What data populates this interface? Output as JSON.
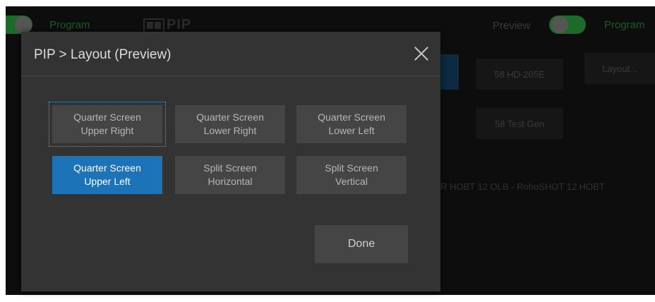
{
  "background": {
    "program_left": "Program",
    "title": "PIP",
    "preview": "Preview",
    "program_right": "Program",
    "btn_hd": "58 HD-205E",
    "btn_layout": "Layout...",
    "btn_testgen": "58 Test Gen",
    "ticker": "R HOBT 12 OLB - RoboSHOT 12 HOBT"
  },
  "modal": {
    "title": "PIP > Layout (Preview)",
    "options": [
      {
        "line1": "Quarter Screen",
        "line2": "Upper Right"
      },
      {
        "line1": "Quarter Screen",
        "line2": "Lower Right"
      },
      {
        "line1": "Quarter Screen",
        "line2": "Lower Left"
      },
      {
        "line1": "Quarter Screen",
        "line2": "Upper Left"
      },
      {
        "line1": "Split Screen",
        "line2": "Horizontal"
      },
      {
        "line1": "Split Screen",
        "line2": "Vertical"
      }
    ],
    "done_label": "Done"
  },
  "colors": {
    "selected": "#1d73b8",
    "modal_bg": "#333333",
    "button_bg": "#454545"
  }
}
